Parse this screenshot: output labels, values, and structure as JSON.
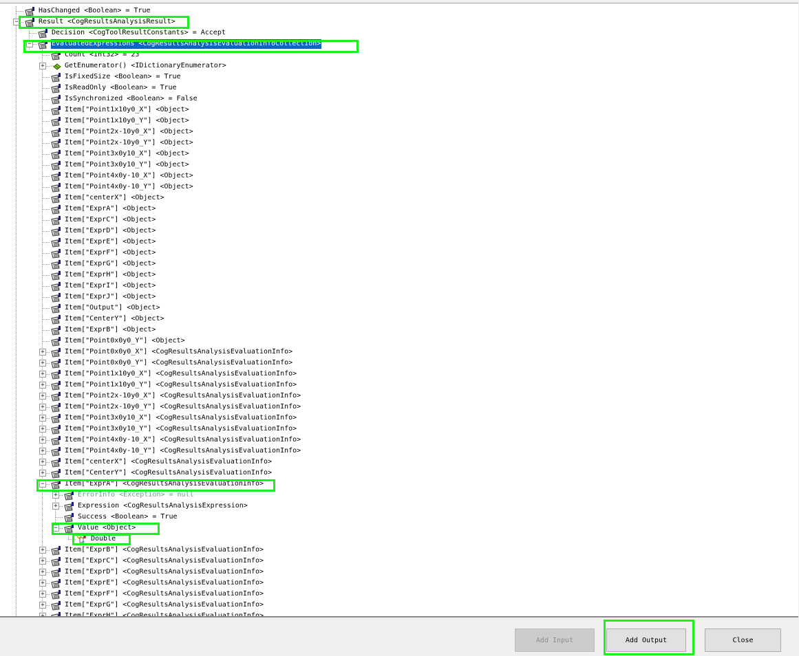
{
  "tree": {
    "rows": [
      {
        "label": "HasChanged <Boolean> = True",
        "level": 1,
        "exp": "",
        "icon": "property-icon"
      },
      {
        "label": "Result <CogResultsAnalysisResult>",
        "level": 1,
        "exp": "minus",
        "icon": "property-icon"
      },
      {
        "label": "Decision <CogToolResultConstants> = Accept",
        "level": 2,
        "exp": "",
        "icon": "property-icon"
      },
      {
        "label": "EvaluatedExpressions <CogResultsAnalysisEvaluationInfoCollection>",
        "level": 2,
        "exp": "minus",
        "icon": "property-icon",
        "selected": true
      },
      {
        "label": "Count <Int32> = 23",
        "level": 3,
        "exp": "",
        "icon": "property-icon"
      },
      {
        "label": "GetEnumerator() <IDictionaryEnumerator>",
        "level": 3,
        "exp": "plus",
        "icon": "method-icon"
      },
      {
        "label": "IsFixedSize <Boolean> = True",
        "level": 3,
        "exp": "",
        "icon": "property-icon"
      },
      {
        "label": "IsReadOnly <Boolean> = True",
        "level": 3,
        "exp": "",
        "icon": "property-icon"
      },
      {
        "label": "IsSynchronized <Boolean> = False",
        "level": 3,
        "exp": "",
        "icon": "property-icon"
      },
      {
        "label": "Item[\"Point1x10y0_X\"] <Object>",
        "level": 3,
        "exp": "",
        "icon": "property-icon"
      },
      {
        "label": "Item[\"Point1x10y0_Y\"] <Object>",
        "level": 3,
        "exp": "",
        "icon": "property-icon"
      },
      {
        "label": "Item[\"Point2x-10y0_X\"] <Object>",
        "level": 3,
        "exp": "",
        "icon": "property-icon"
      },
      {
        "label": "Item[\"Point2x-10y0_Y\"] <Object>",
        "level": 3,
        "exp": "",
        "icon": "property-icon"
      },
      {
        "label": "Item[\"Point3x0y10_X\"] <Object>",
        "level": 3,
        "exp": "",
        "icon": "property-icon"
      },
      {
        "label": "Item[\"Point3x0y10_Y\"] <Object>",
        "level": 3,
        "exp": "",
        "icon": "property-icon"
      },
      {
        "label": "Item[\"Point4x0y-10_X\"] <Object>",
        "level": 3,
        "exp": "",
        "icon": "property-icon"
      },
      {
        "label": "Item[\"Point4x0y-10_Y\"] <Object>",
        "level": 3,
        "exp": "",
        "icon": "property-icon"
      },
      {
        "label": "Item[\"centerX\"] <Object>",
        "level": 3,
        "exp": "",
        "icon": "property-icon"
      },
      {
        "label": "Item[\"ExprA\"] <Object>",
        "level": 3,
        "exp": "",
        "icon": "property-icon"
      },
      {
        "label": "Item[\"ExprC\"] <Object>",
        "level": 3,
        "exp": "",
        "icon": "property-icon"
      },
      {
        "label": "Item[\"ExprD\"] <Object>",
        "level": 3,
        "exp": "",
        "icon": "property-icon"
      },
      {
        "label": "Item[\"ExprE\"] <Object>",
        "level": 3,
        "exp": "",
        "icon": "property-icon"
      },
      {
        "label": "Item[\"ExprF\"] <Object>",
        "level": 3,
        "exp": "",
        "icon": "property-icon"
      },
      {
        "label": "Item[\"ExprG\"] <Object>",
        "level": 3,
        "exp": "",
        "icon": "property-icon"
      },
      {
        "label": "Item[\"ExprH\"] <Object>",
        "level": 3,
        "exp": "",
        "icon": "property-icon"
      },
      {
        "label": "Item[\"ExprI\"] <Object>",
        "level": 3,
        "exp": "",
        "icon": "property-icon"
      },
      {
        "label": "Item[\"ExprJ\"] <Object>",
        "level": 3,
        "exp": "",
        "icon": "property-icon"
      },
      {
        "label": "Item[\"Output\"] <Object>",
        "level": 3,
        "exp": "",
        "icon": "property-icon"
      },
      {
        "label": "Item[\"CenterY\"] <Object>",
        "level": 3,
        "exp": "",
        "icon": "property-icon"
      },
      {
        "label": "Item[\"ExprB\"] <Object>",
        "level": 3,
        "exp": "",
        "icon": "property-icon"
      },
      {
        "label": "Item[\"Point0x0y0_Y\"] <Object>",
        "level": 3,
        "exp": "",
        "icon": "property-icon"
      },
      {
        "label": "Item[\"Point0x0y0_X\"] <CogResultsAnalysisEvaluationInfo>",
        "level": 3,
        "exp": "plus",
        "icon": "property-icon"
      },
      {
        "label": "Item[\"Point0x0y0_Y\"] <CogResultsAnalysisEvaluationInfo>",
        "level": 3,
        "exp": "plus",
        "icon": "property-icon"
      },
      {
        "label": "Item[\"Point1x10y0_X\"] <CogResultsAnalysisEvaluationInfo>",
        "level": 3,
        "exp": "plus",
        "icon": "property-icon"
      },
      {
        "label": "Item[\"Point1x10y0_Y\"] <CogResultsAnalysisEvaluationInfo>",
        "level": 3,
        "exp": "plus",
        "icon": "property-icon"
      },
      {
        "label": "Item[\"Point2x-10y0_X\"] <CogResultsAnalysisEvaluationInfo>",
        "level": 3,
        "exp": "plus",
        "icon": "property-icon"
      },
      {
        "label": "Item[\"Point2x-10y0_Y\"] <CogResultsAnalysisEvaluationInfo>",
        "level": 3,
        "exp": "plus",
        "icon": "property-icon"
      },
      {
        "label": "Item[\"Point3x0y10_X\"] <CogResultsAnalysisEvaluationInfo>",
        "level": 3,
        "exp": "plus",
        "icon": "property-icon"
      },
      {
        "label": "Item[\"Point3x0y10_Y\"] <CogResultsAnalysisEvaluationInfo>",
        "level": 3,
        "exp": "plus",
        "icon": "property-icon"
      },
      {
        "label": "Item[\"Point4x0y-10_X\"] <CogResultsAnalysisEvaluationInfo>",
        "level": 3,
        "exp": "plus",
        "icon": "property-icon"
      },
      {
        "label": "Item[\"Point4x0y-10_Y\"] <CogResultsAnalysisEvaluationInfo>",
        "level": 3,
        "exp": "plus",
        "icon": "property-icon"
      },
      {
        "label": "Item[\"centerX\"] <CogResultsAnalysisEvaluationInfo>",
        "level": 3,
        "exp": "plus",
        "icon": "property-icon"
      },
      {
        "label": "Item[\"CenterY\"] <CogResultsAnalysisEvaluationInfo>",
        "level": 3,
        "exp": "plus",
        "icon": "property-icon"
      },
      {
        "label": "Item[\"ExprA\"] <CogResultsAnalysisEvaluationInfo>",
        "level": 3,
        "exp": "minus",
        "icon": "property-icon"
      },
      {
        "label": "ErrorInfo <Exception> = null",
        "level": 4,
        "exp": "plus",
        "icon": "property-icon",
        "gray": true
      },
      {
        "label": "Expression <CogResultsAnalysisExpression>",
        "level": 4,
        "exp": "plus",
        "icon": "property-icon"
      },
      {
        "label": "Success <Boolean> = True",
        "level": 4,
        "exp": "",
        "icon": "property-icon"
      },
      {
        "label": "Value <Object>",
        "level": 4,
        "exp": "minus",
        "icon": "property-icon"
      },
      {
        "label": "Double",
        "level": 5,
        "exp": "",
        "icon": "type-icon"
      },
      {
        "label": "Item[\"ExprB\"] <CogResultsAnalysisEvaluationInfo>",
        "level": 3,
        "exp": "plus",
        "icon": "property-icon"
      },
      {
        "label": "Item[\"ExprC\"] <CogResultsAnalysisEvaluationInfo>",
        "level": 3,
        "exp": "plus",
        "icon": "property-icon"
      },
      {
        "label": "Item[\"ExprD\"] <CogResultsAnalysisEvaluationInfo>",
        "level": 3,
        "exp": "plus",
        "icon": "property-icon"
      },
      {
        "label": "Item[\"ExprE\"] <CogResultsAnalysisEvaluationInfo>",
        "level": 3,
        "exp": "plus",
        "icon": "property-icon"
      },
      {
        "label": "Item[\"ExprF\"] <CogResultsAnalysisEvaluationInfo>",
        "level": 3,
        "exp": "plus",
        "icon": "property-icon"
      },
      {
        "label": "Item[\"ExprG\"] <CogResultsAnalysisEvaluationInfo>",
        "level": 3,
        "exp": "plus",
        "icon": "property-icon"
      },
      {
        "label": "Item[\"ExprH\"] <CogResultsAnalysisEvaluationInfo>",
        "level": 3,
        "exp": "plus",
        "icon": "property-icon"
      }
    ]
  },
  "buttons": {
    "add_input": "Add Input",
    "add_output": "Add Output",
    "close": "Close"
  },
  "colors": {
    "selection": "#0a64c8",
    "highlight_box": "#1ef01e",
    "disabled_text": "#8d8d8d"
  }
}
